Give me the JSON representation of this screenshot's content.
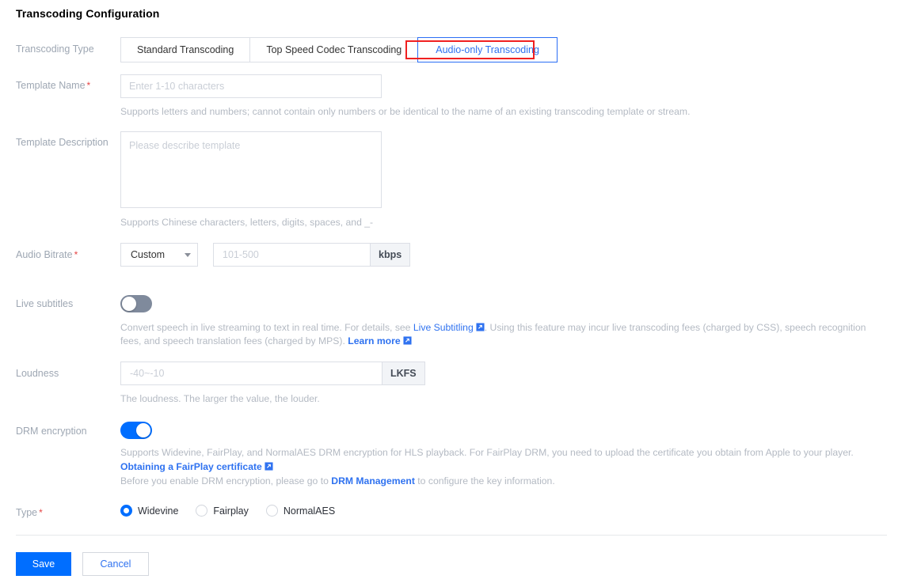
{
  "page": {
    "title": "Transcoding Configuration"
  },
  "transcoding_type": {
    "label": "Transcoding Type",
    "tabs": [
      {
        "label": "Standard Transcoding",
        "active": false
      },
      {
        "label": "Top Speed Codec Transcoding",
        "active": false
      },
      {
        "label": "Audio-only Transcoding",
        "active": true
      }
    ],
    "highlight_color": "#f02020",
    "active_color": "#2f72f0"
  },
  "template_name": {
    "label": "Template Name",
    "required": "*",
    "placeholder": "Enter 1-10 characters",
    "value": "",
    "hint": "Supports letters and numbers; cannot contain only numbers or be identical to the name of an existing transcoding template or stream."
  },
  "template_description": {
    "label": "Template Description",
    "placeholder": "Please describe template",
    "value": "",
    "hint": "Supports Chinese characters, letters, digits, spaces, and _-"
  },
  "audio_bitrate": {
    "label": "Audio Bitrate",
    "required": "*",
    "select_value": "Custom",
    "options": [
      "Custom"
    ],
    "placeholder": "101-500",
    "value": "",
    "unit": "kbps"
  },
  "live_subtitles": {
    "label": "Live subtitles",
    "enabled": false,
    "hint_part1": "Convert speech in live streaming to text in real time. For details, see",
    "link1": "Live Subtitling",
    "hint_part2": ". Using this feature may incur live transcoding fees (charged by CSS), speech recognition fees, and speech translation fees (charged by MPS).",
    "link2": "Learn more"
  },
  "loudness": {
    "label": "Loudness",
    "placeholder": "-40~-10",
    "value": "",
    "unit": "LKFS",
    "hint": "The loudness. The larger the value, the louder."
  },
  "drm_encryption": {
    "label": "DRM encryption",
    "enabled": true,
    "hint1": "Supports Widevine, FairPlay, and NormalAES DRM encryption for HLS playback. For FairPlay DRM, you need to upload the certificate you obtain from Apple to your player.",
    "link_certificate": "Obtaining a FairPlay certificate",
    "hint2_prefix": "Before you enable DRM encryption, please go to",
    "link_drm_management": "DRM Management",
    "hint2_suffix": "to configure the key information."
  },
  "type": {
    "label": "Type",
    "required": "*",
    "options": [
      {
        "label": "Widevine",
        "selected": true
      },
      {
        "label": "Fairplay",
        "selected": false
      },
      {
        "label": "NormalAES",
        "selected": false
      }
    ]
  },
  "footer": {
    "save_label": "Save",
    "cancel_label": "Cancel",
    "primary_color": "#006eff"
  }
}
